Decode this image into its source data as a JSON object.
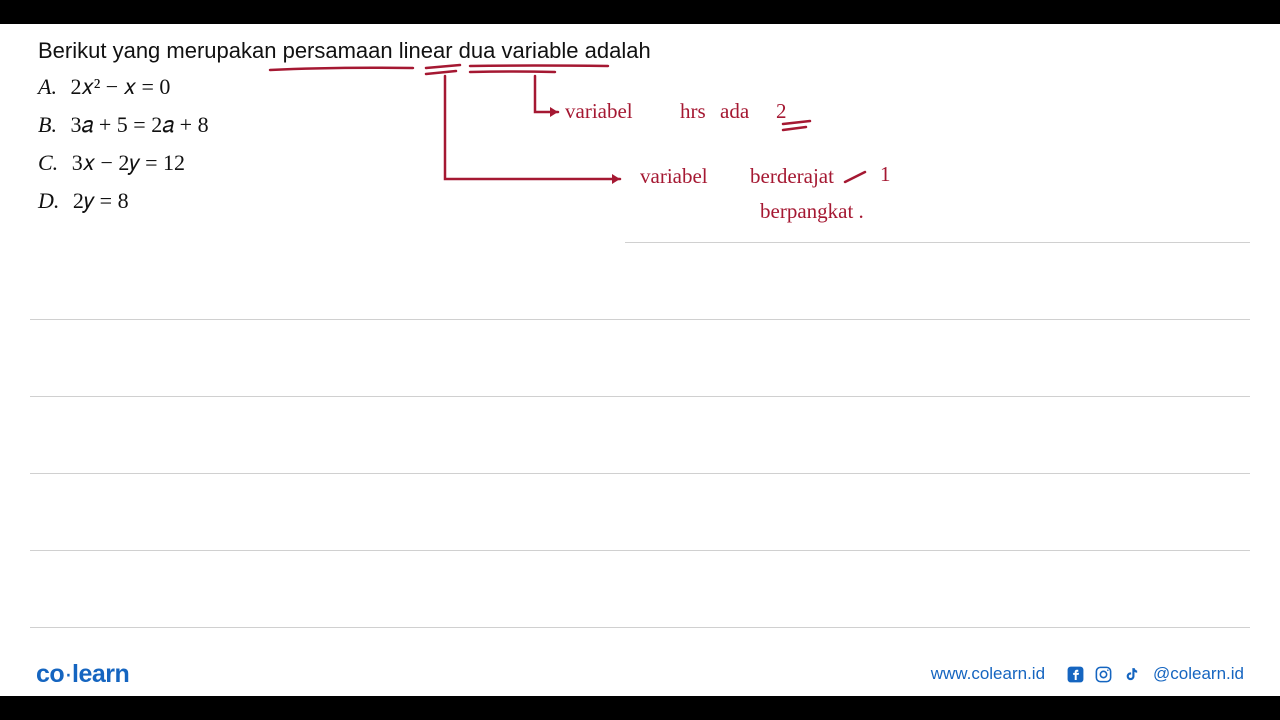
{
  "question": "Berikut yang merupakan persamaan linear dua variable adalah",
  "options": {
    "a_letter": "A.",
    "a_eq": "2𝑥² − 𝑥 = 0",
    "b_letter": "B.",
    "b_eq": "3𝑎 + 5 = 2𝑎 + 8",
    "c_letter": "C.",
    "c_eq": "3𝑥 − 2𝑦 = 12",
    "d_letter": "D.",
    "d_eq": "2𝑦 = 8"
  },
  "annotations": {
    "line1_a": "variabel",
    "line1_b": "hrs",
    "line1_c": "ada",
    "line1_d": "2",
    "line2_a": "variabel",
    "line2_b": "berderajat",
    "line2_c": "1",
    "line3": "berpangkat ."
  },
  "footer": {
    "logo_co": "co",
    "logo_dot": "·",
    "logo_learn": "learn",
    "url": "www.colearn.id",
    "handle": "@colearn.id"
  },
  "colors": {
    "annotation": "#a51832",
    "brand": "#1565c0"
  }
}
